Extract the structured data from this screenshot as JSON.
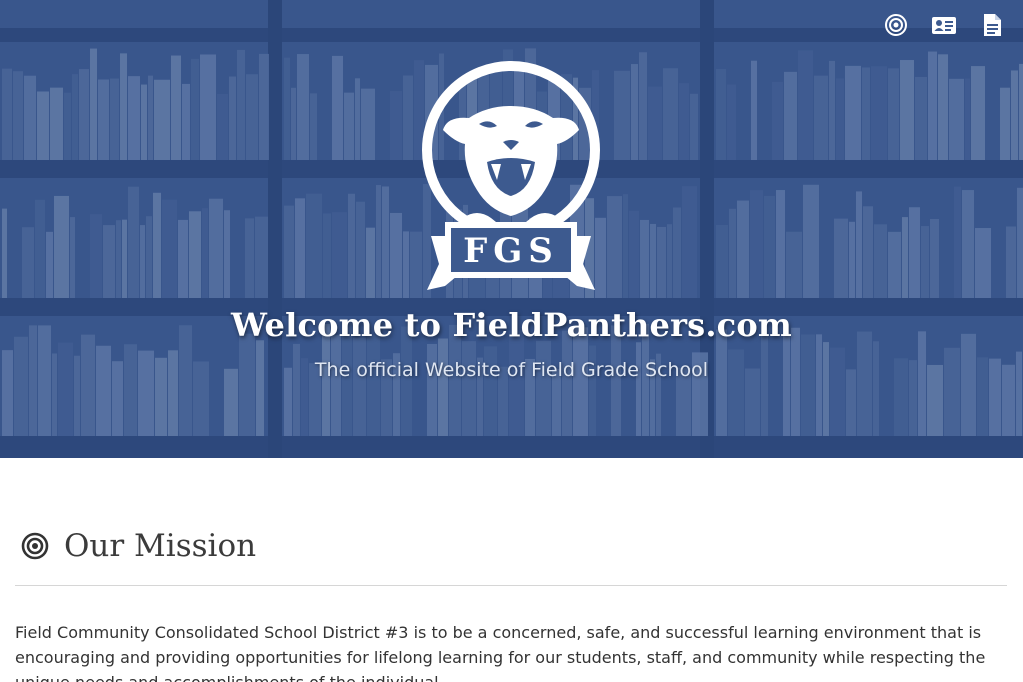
{
  "hero": {
    "title": "Welcome to FieldPanthers.com",
    "subtitle": "The official Website of Field Grade School",
    "logo_text": "FGS",
    "overlay_color": "#2c4a82"
  },
  "nav": {
    "icons": [
      "target-icon",
      "id-card-icon",
      "document-icon"
    ]
  },
  "mission": {
    "heading": "Our Mission",
    "text": "Field Community Consolidated School District #3 is to be a concerned, safe, and successful learning environment that is encouraging and providing opportunities for lifelong learning for our students, staff, and community while respecting the unique needs and accomplishments of the individual."
  }
}
